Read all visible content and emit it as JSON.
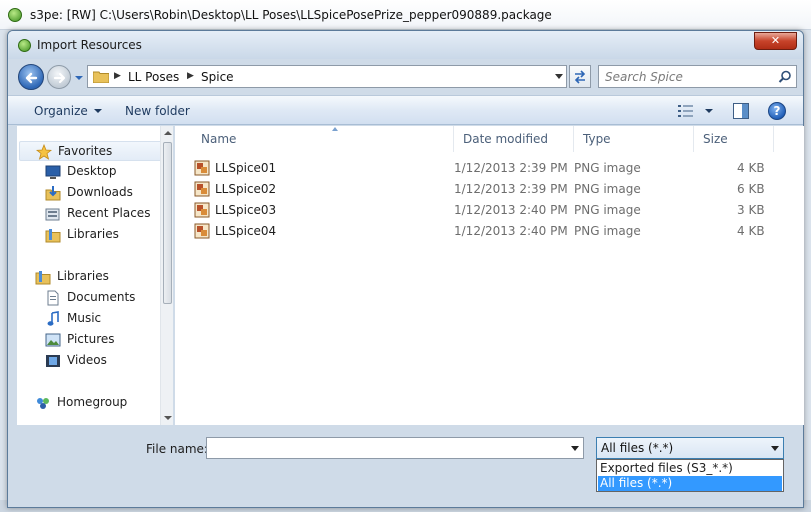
{
  "app": {
    "title": "s3pe: [RW] C:\\Users\\Robin\\Desktop\\LL Poses\\LLSpicePosePrize_pepper090889.package"
  },
  "dialog": {
    "title": "Import Resources",
    "close_label": "✕"
  },
  "address": {
    "crumbs": [
      "LL Poses",
      "Spice"
    ]
  },
  "search": {
    "placeholder": "Search Spice"
  },
  "toolbar": {
    "organize_label": "Organize",
    "new_folder_label": "New folder",
    "help_label": "?"
  },
  "navpane": {
    "favorites": {
      "label": "Favorites",
      "items": [
        {
          "label": "Desktop",
          "icon": "desktop-icon"
        },
        {
          "label": "Downloads",
          "icon": "downloads-icon"
        },
        {
          "label": "Recent Places",
          "icon": "recent-places-icon"
        },
        {
          "label": "Libraries",
          "icon": "libraries-icon"
        }
      ]
    },
    "libraries": {
      "label": "Libraries",
      "items": [
        {
          "label": "Documents",
          "icon": "documents-icon"
        },
        {
          "label": "Music",
          "icon": "music-icon"
        },
        {
          "label": "Pictures",
          "icon": "pictures-icon"
        },
        {
          "label": "Videos",
          "icon": "videos-icon"
        }
      ]
    },
    "homegroup": {
      "label": "Homegroup"
    }
  },
  "filelist": {
    "columns": [
      "Name",
      "Date modified",
      "Type",
      "Size"
    ],
    "rows": [
      {
        "name": "LLSpice01",
        "date": "1/12/2013 2:39 PM",
        "type": "PNG image",
        "size": "4 KB"
      },
      {
        "name": "LLSpice02",
        "date": "1/12/2013 2:39 PM",
        "type": "PNG image",
        "size": "6 KB"
      },
      {
        "name": "LLSpice03",
        "date": "1/12/2013 2:40 PM",
        "type": "PNG image",
        "size": "3 KB"
      },
      {
        "name": "LLSpice04",
        "date": "1/12/2013 2:40 PM",
        "type": "PNG image",
        "size": "4 KB"
      }
    ]
  },
  "filename": {
    "label": "File name:",
    "value": ""
  },
  "filter": {
    "selected": "All files (*.*)",
    "options": [
      "Exported files (S3_*.*)",
      "All files (*.*)"
    ],
    "selected_index": 1
  },
  "colors": {
    "selection": "#3399ff",
    "dialog_frame": "#cfdbe8",
    "close_button": "#c7432a"
  }
}
